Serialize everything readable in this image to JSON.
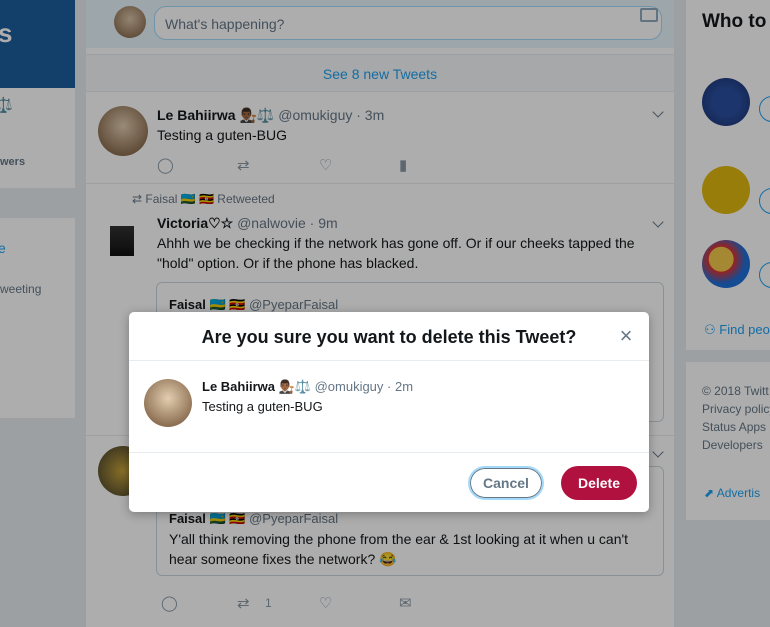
{
  "left": {
    "banner_fragment": "s",
    "emoji_fragment": "⚖️",
    "followers_fragment": "wers",
    "trend_fragment": "e",
    "tweeting_fragment": "weeting"
  },
  "composer": {
    "placeholder": "What's happening?"
  },
  "timeline": {
    "new_tweets": "See 8 new Tweets",
    "tweet1": {
      "name": "Le Bahiirwa 👨🏾‍⚖️⚖️",
      "handle": "@omukiguy · 3m",
      "text": "Testing a guten-BUG"
    },
    "retweet": {
      "retweeted_by": "Faisal 🇷🇼 🇺🇬 Retweeted",
      "name": "Victoria♡☆",
      "handle": "@nalwovie · 9m",
      "text": "Ahhh we be checking if the network has gone off. Or if our cheeks tapped the \"hold\" option. Or if the phone has blacked.",
      "quote_name": "Faisal 🇷🇼 🇺🇬",
      "quote_handle": "@PyeparFaisal"
    },
    "tweet3": {
      "quote_name": "Faisal 🇷🇼 🇺🇬",
      "quote_handle": "@PyeparFaisal",
      "quote_text": "Y'all think removing the phone from the ear & 1st looking at it when u can't hear someone fixes the network? 😂",
      "retweet_count": "1"
    }
  },
  "right": {
    "who_to_follow": "Who to",
    "find_people": "Find peo",
    "footer": [
      "© 2018 Twitt",
      "Privacy policy",
      "Status  Apps",
      "Developers"
    ],
    "advertise": "Advertis"
  },
  "modal": {
    "title": "Are you sure you want to delete this Tweet?",
    "close": "×",
    "tweet": {
      "name": "Le Bahiirwa 👨🏾‍⚖️⚖️",
      "handle": "@omukiguy · 2m",
      "text": "Testing a guten-BUG"
    },
    "cancel_label": "Cancel",
    "delete_label": "Delete"
  },
  "colors": {
    "accent": "#1da1f2",
    "delete": "#b0113e",
    "overlay": "rgba(0,0,0,0.32)"
  }
}
